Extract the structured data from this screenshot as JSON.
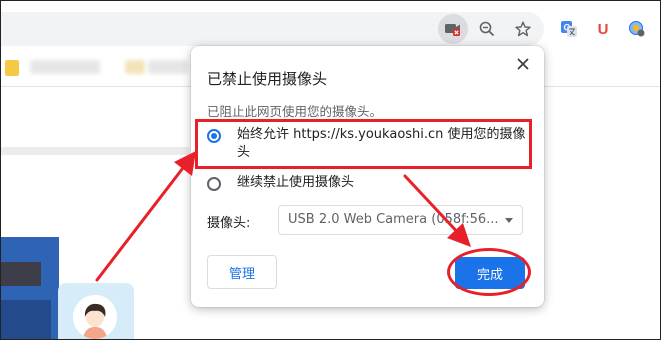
{
  "popup": {
    "title": "已禁止使用摄像头",
    "description": "已阻止此网页使用您的摄像头。",
    "options": [
      {
        "label": "始终允许 https://ks.youkaoshi.cn 使用您的摄像头",
        "selected": true
      },
      {
        "label": "继续禁止使用摄像头",
        "selected": false
      }
    ],
    "camera_label": "摄像头:",
    "camera_value": "USB 2.0 Web Camera (058f:56...",
    "manage_label": "管理",
    "done_label": "完成"
  },
  "extensions": {
    "u_label": "U"
  },
  "colors": {
    "accent": "#1a73e8",
    "annotation": "#e8202a"
  },
  "icons": [
    "camera-blocked-icon",
    "zoom-icon",
    "star-icon",
    "translate-icon",
    "close-icon",
    "avatar-icon"
  ]
}
